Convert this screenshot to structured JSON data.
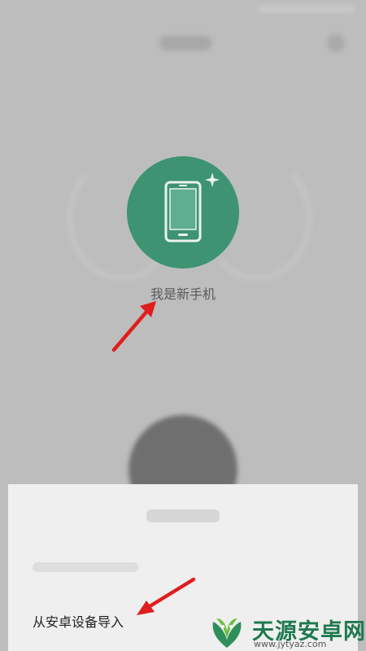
{
  "header": {
    "title": ""
  },
  "phone_type": {
    "new_phone_label": "我是新手机"
  },
  "import_sheet": {
    "title": "",
    "option_android": "从安卓设备导入"
  },
  "watermark": {
    "name": "天源安卓网",
    "url": "www.jytyaz.com"
  },
  "icons": {
    "phone": "phone-icon",
    "sparkle": "sparkle-icon",
    "arrow": "red-arrow-icon"
  },
  "colors": {
    "accent_green": "#3d9372",
    "arrow_red": "#e01e1e",
    "watermark_green": "#1f7a4f"
  }
}
